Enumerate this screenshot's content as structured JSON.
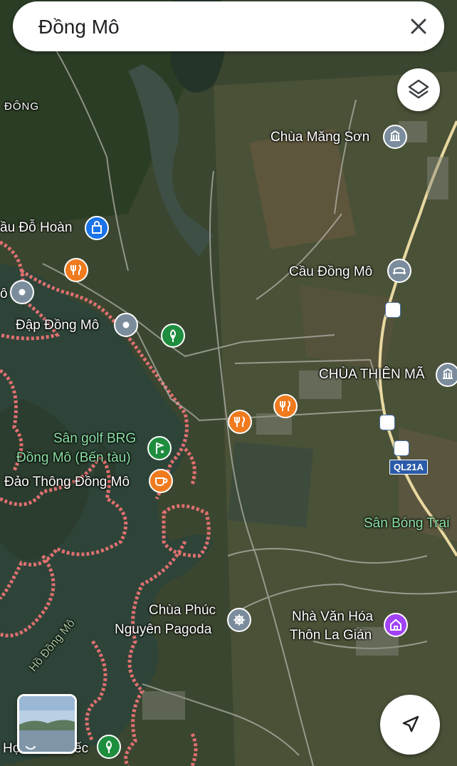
{
  "search": {
    "query": "Đồng Mô"
  },
  "icons": {
    "close": "close-icon",
    "layers": "layers-icon",
    "my_location": "navigation-arrow-icon"
  },
  "places": {
    "dong_top": "ĐÔNG",
    "chua_mang_son": "Chùa Măng Sơn",
    "cau_do_hoan": "ầu Đỗ Hoàn",
    "cau_dong_mo": "Cầu Đồng Mô",
    "dap_dong_mo": "Đập Đồng Mô",
    "chua_thien_ma": "CHÙA THIÊN MÃ",
    "golf_line1": "Sân golf BRG",
    "golf_line2": "Đồng Mô (Bến tàu)",
    "dao_thong": "Đảo Thông Đồng Mô",
    "san_bong": "Sân Bóng Trại",
    "chua_phuc_line1": "Chùa Phúc",
    "chua_phuc_line2": "Nguyên Pagoda",
    "nha_van_hoa_line1": "Nhà Văn Hóa",
    "nha_van_hoa_line2": "Thôn La Gián",
    "ho_dong_mo": "Hồ Đồng Mô",
    "bottom_left": "Họ",
    "bottom_left2": "ếc",
    "left_edge": "ô"
  },
  "road_shield": "QL21A",
  "colors": {
    "restaurant": "#f07b1f",
    "park": "#1e8e3e",
    "landmark": "#7b8d9c",
    "shopping": "#1a73e8",
    "community": "#a142f4",
    "boundary": "#e06666",
    "highway": "#e9d9a0"
  }
}
